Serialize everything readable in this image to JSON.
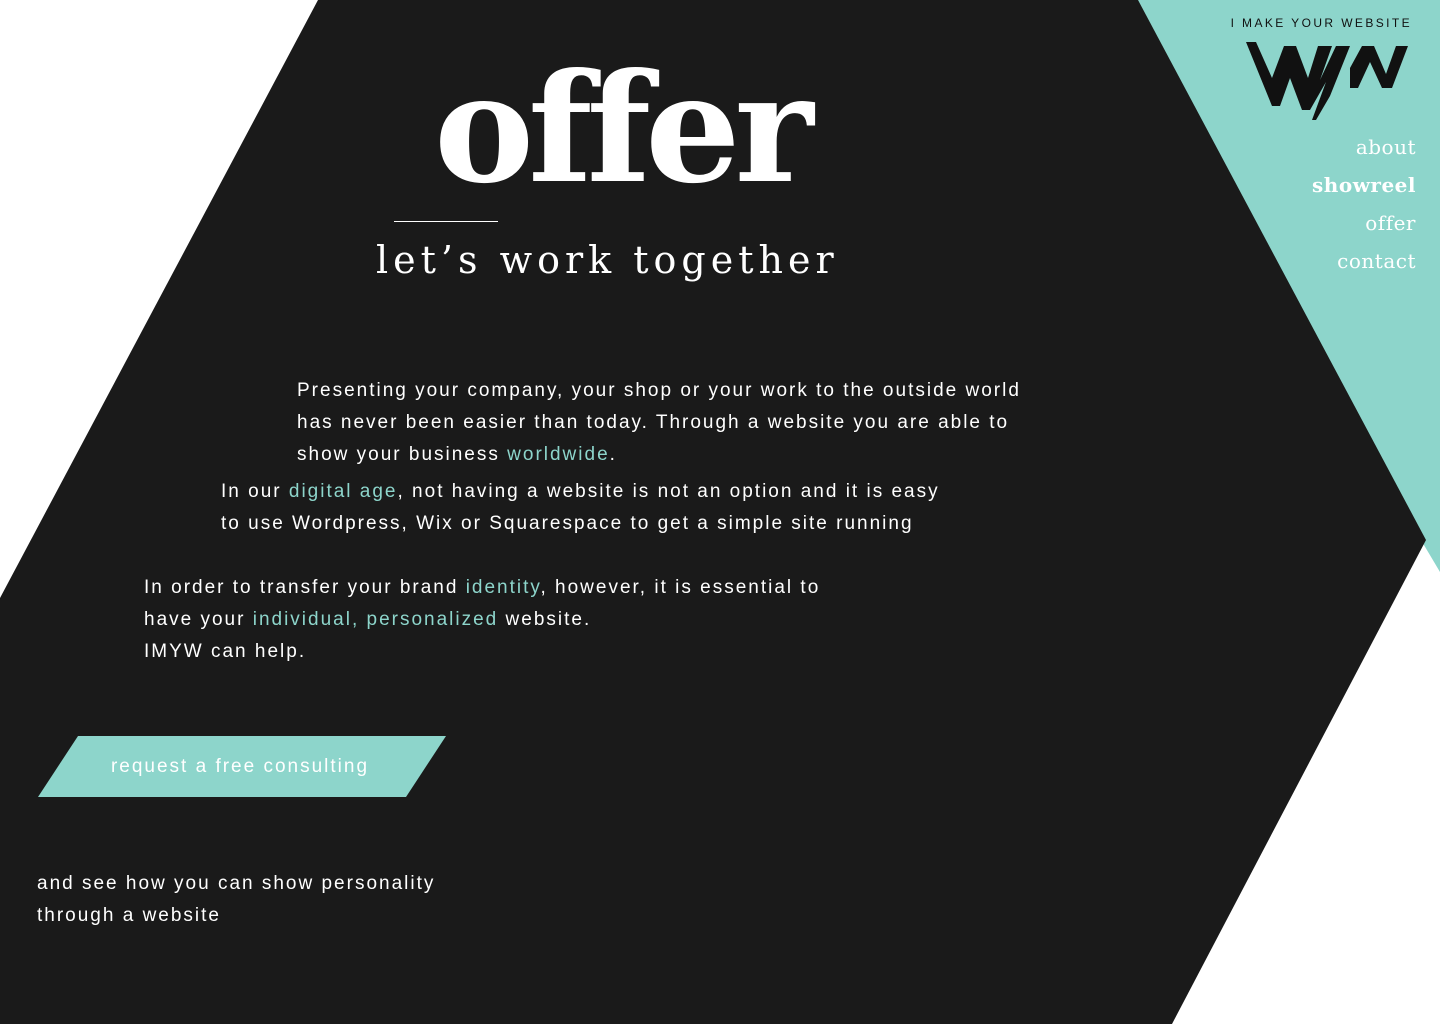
{
  "brand": {
    "tagline": "I MAKE YOUR WEBSITE",
    "logo_icon": "imyw-zigzag-logo"
  },
  "nav": {
    "items": [
      {
        "label": "about",
        "active": false
      },
      {
        "label": "showreel",
        "active": true
      },
      {
        "label": "offer",
        "active": false
      },
      {
        "label": "contact",
        "active": false
      }
    ]
  },
  "hero": {
    "title": "offer",
    "subtitle": "let’s work together"
  },
  "content": {
    "p1": {
      "pre": "Presenting your company, your shop or your work to the outside world has never been easier than today. Through a website you are able to show your business ",
      "hl": "worldwide",
      "post": "."
    },
    "p2": {
      "pre": "In our ",
      "hl": "digital age",
      "post": ", not having a website is not an option and it is easy to use Wordpress, Wix or Squarespace to get a simple site running"
    },
    "p3": {
      "pre": "In order to transfer your brand ",
      "hl1": "identity",
      "mid": ", however, it is essential to have your ",
      "hl2": "individual, personalized",
      "post": " website.",
      "last": "IMYW can help."
    }
  },
  "cta": {
    "label": "request a free consulting"
  },
  "footer": {
    "line1": "and see how you can show personality",
    "line2": "through a website"
  },
  "colors": {
    "dark": "#1a1a1a",
    "accent": "#8dd5cb",
    "white": "#ffffff"
  }
}
